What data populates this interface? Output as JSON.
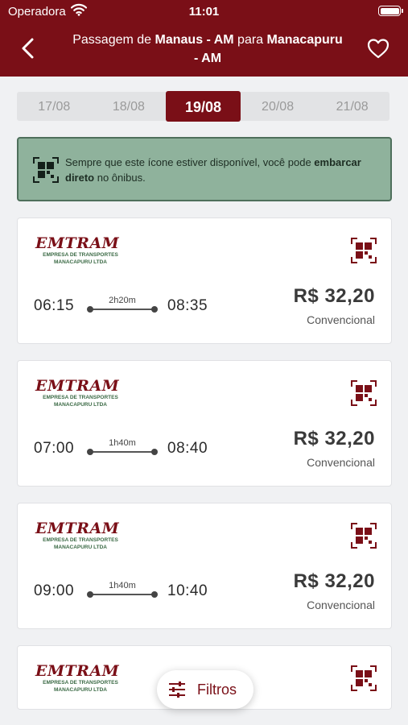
{
  "status_bar": {
    "carrier": "Operadora",
    "time": "11:01"
  },
  "header": {
    "title_prefix": "Passagem de ",
    "origin": "Manaus - AM",
    "connector": " para ",
    "destination_line1": "Manacapuru",
    "destination_line2": "- AM"
  },
  "dates": [
    "17/08",
    "18/08",
    "19/08",
    "20/08",
    "21/08"
  ],
  "selected_date": "19/08",
  "info": {
    "text_before": "Sempre que este ícone estiver disponível, você pode ",
    "bold_text": "embarcar direto",
    "text_after": " no ônibus."
  },
  "company": {
    "name": "EMTRAM",
    "subtitle_line1": "EMPRESA DE TRANSPORTES",
    "subtitle_line2": "MANACAPURU LTDA"
  },
  "trips": [
    {
      "departure": "06:15",
      "duration": "2h20m",
      "arrival": "08:35",
      "price": "R$ 32,20",
      "class": "Convencional"
    },
    {
      "departure": "07:00",
      "duration": "1h40m",
      "arrival": "08:40",
      "price": "R$ 32,20",
      "class": "Convencional"
    },
    {
      "departure": "09:00",
      "duration": "1h40m",
      "arrival": "10:40",
      "price": "R$ 32,20",
      "class": "Convencional"
    },
    {
      "departure": "",
      "duration": "",
      "arrival": "",
      "price": "",
      "class": ""
    }
  ],
  "filter_button": {
    "label": "Filtros"
  },
  "colors": {
    "brand": "#7a0f17",
    "banner_bg": "#8fb29c",
    "banner_border": "#4e6f5b",
    "company_green": "#3b6a45"
  },
  "icons": [
    "wifi-icon",
    "battery-icon",
    "back-chevron-icon",
    "heart-icon",
    "qr-board-icon",
    "filter-sliders-icon"
  ]
}
